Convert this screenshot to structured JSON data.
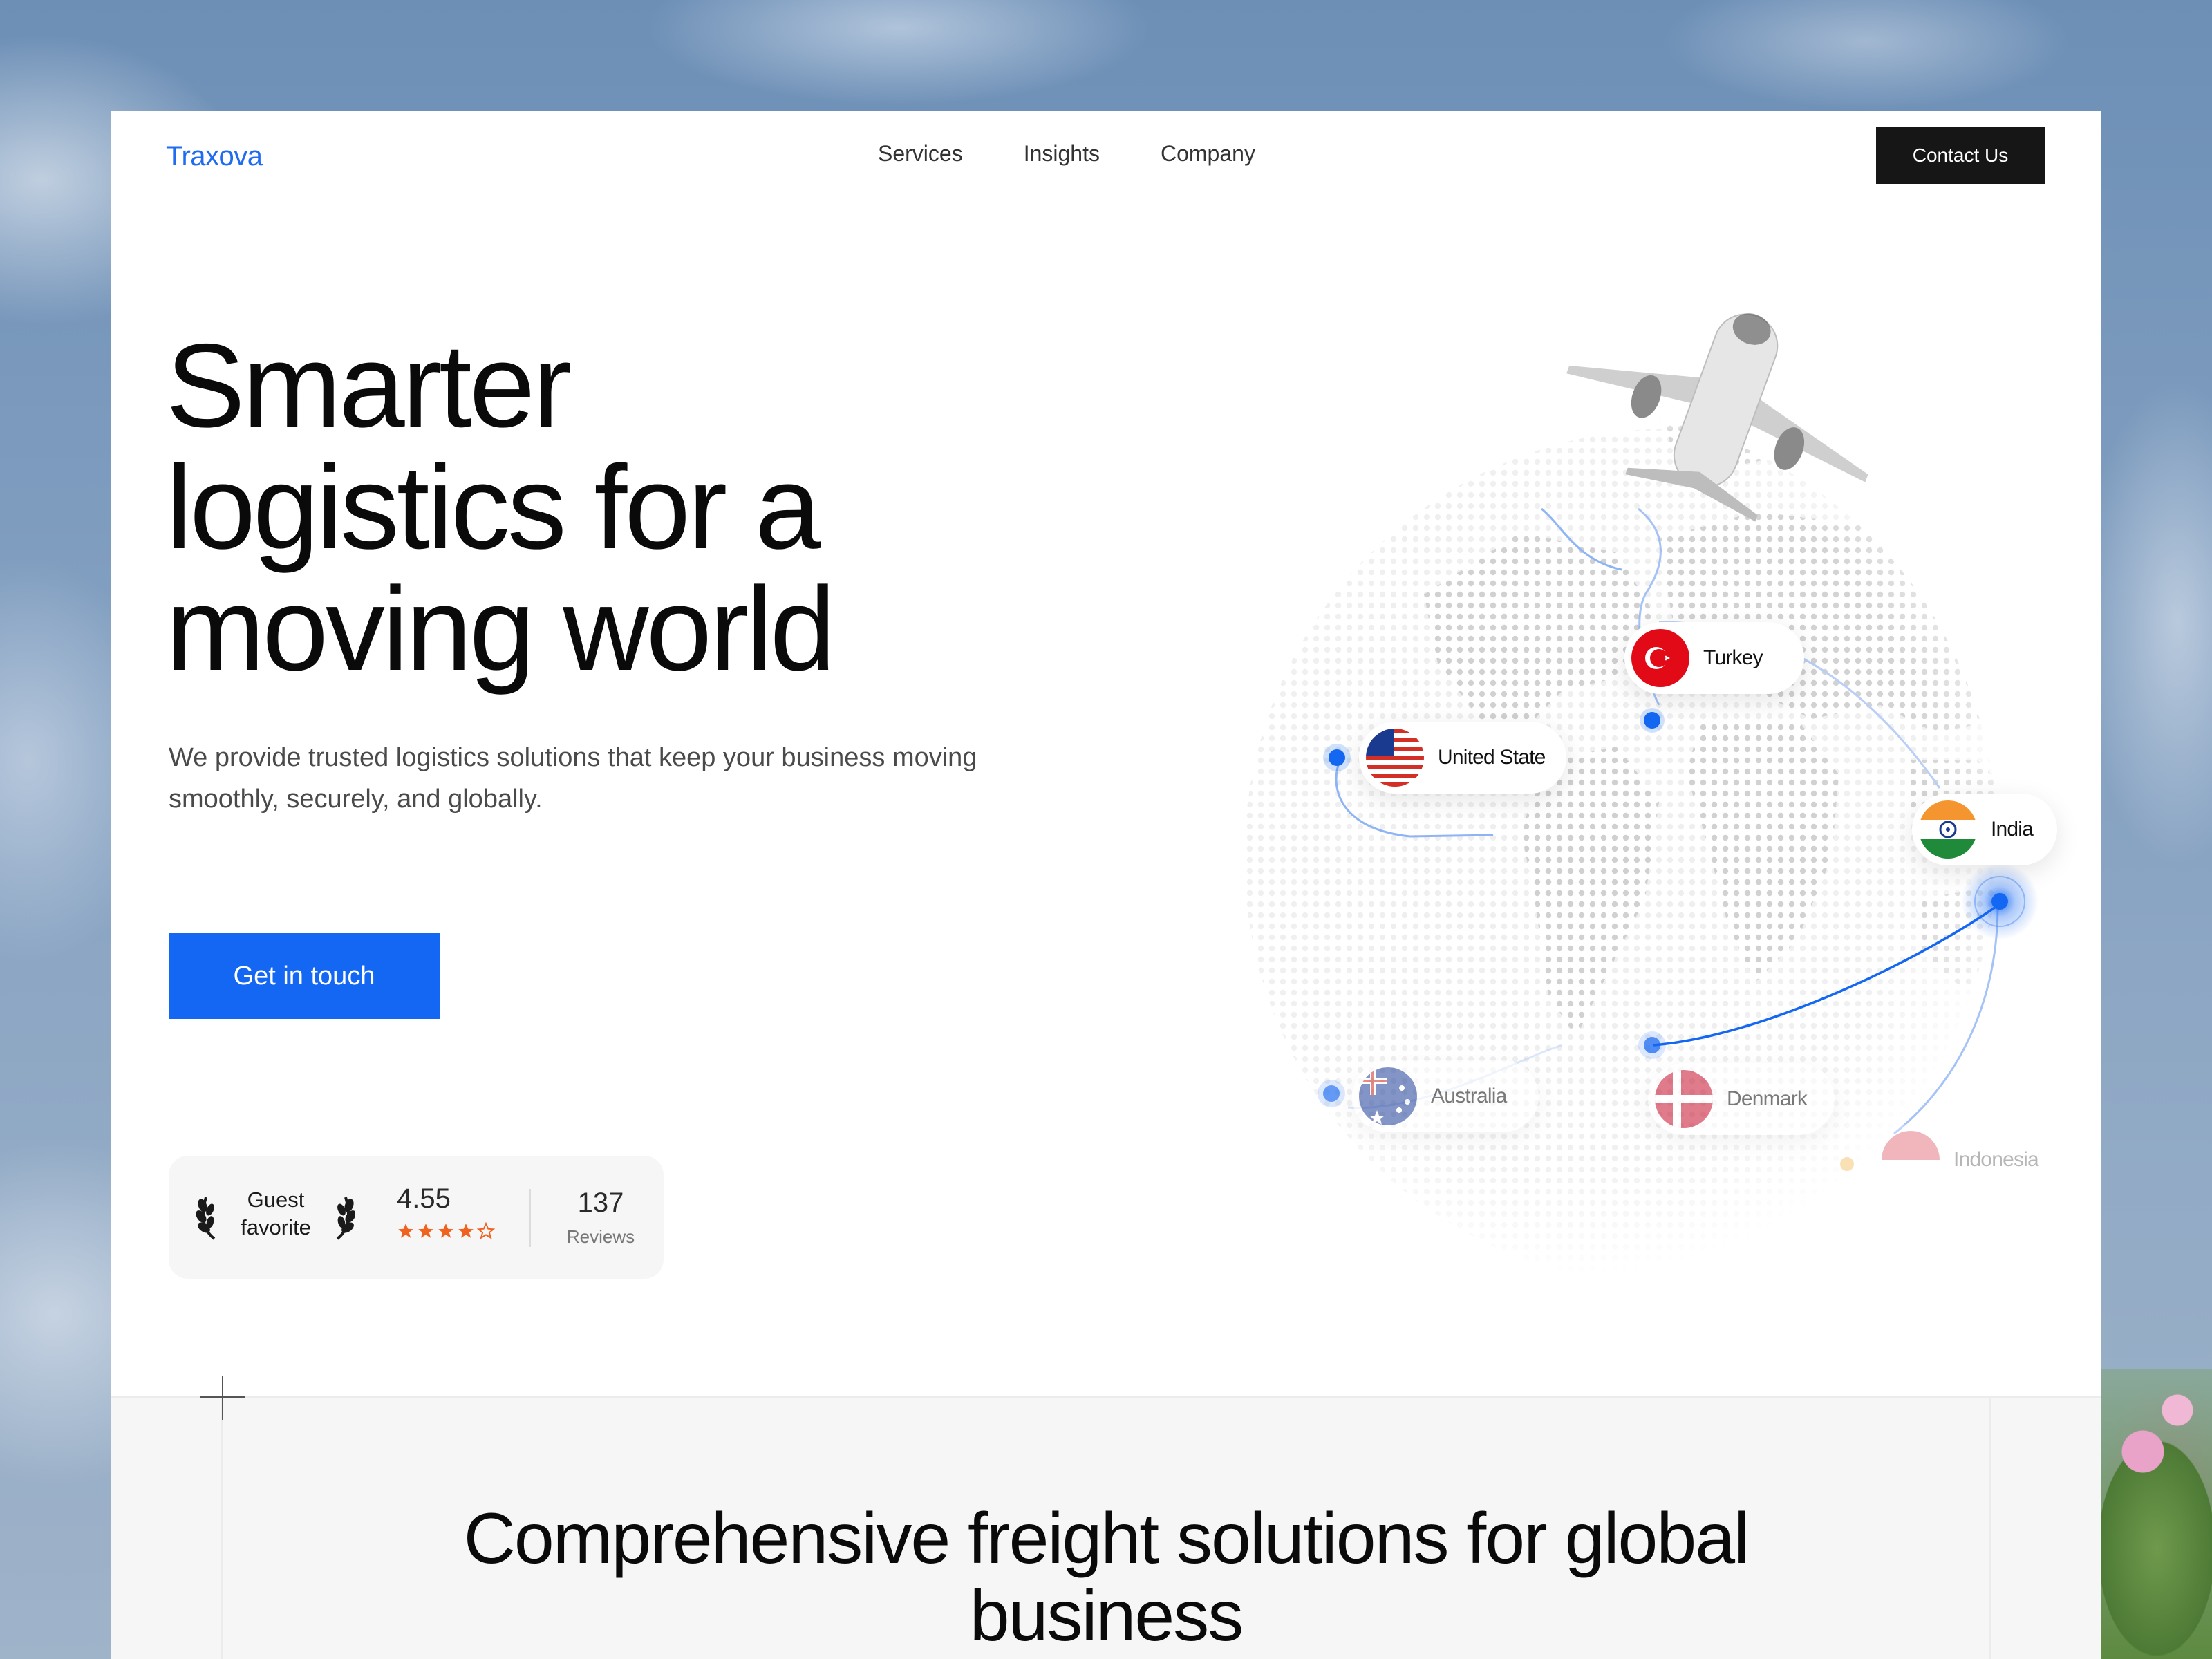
{
  "brand": {
    "name": "Traxova",
    "accent": "#1467f2"
  },
  "nav": {
    "items": [
      "Services",
      "Insights",
      "Company"
    ]
  },
  "header": {
    "contact_label": "Contact Us"
  },
  "hero": {
    "title": "Smarter logistics for a moving world",
    "subtitle": "We provide trusted logistics solutions that keep your business moving smoothly, securely, and globally.",
    "cta_label": "Get in touch"
  },
  "rating": {
    "badge": "Guest favorite",
    "score": "4.55",
    "stars_filled": 4,
    "stars_total": 5,
    "star_color": "#f0621f",
    "review_count": "137",
    "review_label": "Reviews"
  },
  "globe": {
    "countries": [
      "Turkey",
      "United State",
      "India",
      "Australia",
      "Denmark",
      "Indonesia"
    ]
  },
  "section2": {
    "title": "Comprehensive freight solutions for global business"
  }
}
